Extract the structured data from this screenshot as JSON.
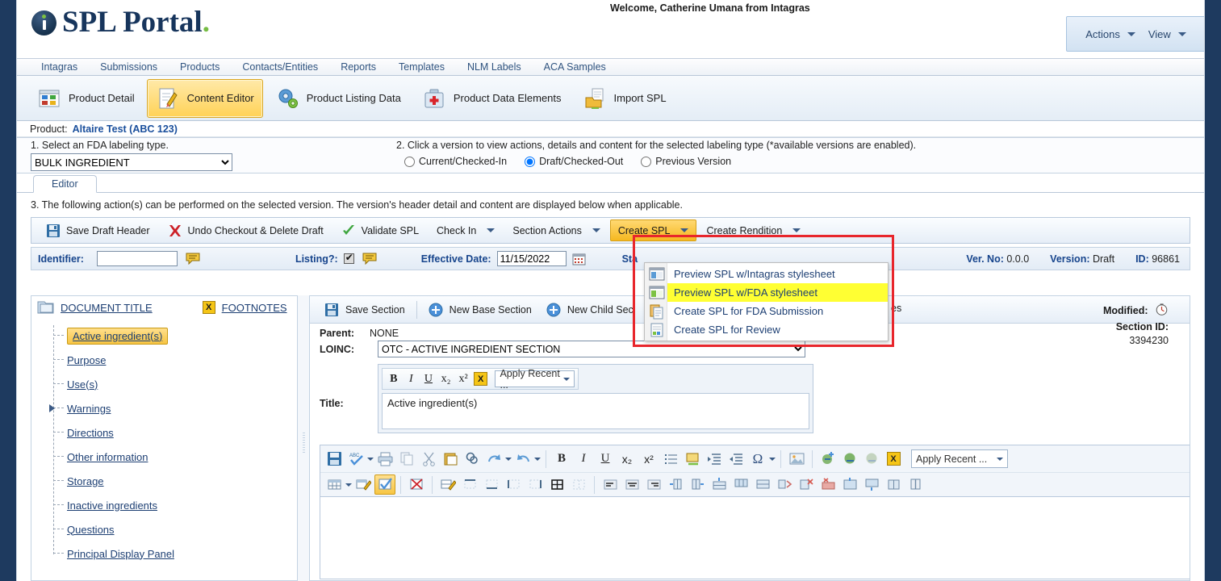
{
  "app": {
    "logo_text": "SPL Portal",
    "logo_dot": ".",
    "welcome": "Welcome, Catherine Umana from Intagras"
  },
  "header_menu": {
    "actions_label": "Actions",
    "view_label": "View"
  },
  "nav": {
    "items": [
      {
        "label": "Intagras"
      },
      {
        "label": "Submissions"
      },
      {
        "label": "Products"
      },
      {
        "label": "Contacts/Entities"
      },
      {
        "label": "Reports"
      },
      {
        "label": "Templates"
      },
      {
        "label": "NLM Labels"
      },
      {
        "label": "ACA Samples"
      }
    ]
  },
  "icon_toolbar": {
    "items": [
      {
        "label": "Product Detail",
        "icon": "grid-icon",
        "active": false
      },
      {
        "label": "Content Editor",
        "icon": "pencil-page-icon",
        "active": true
      },
      {
        "label": "Product Listing Data",
        "icon": "gears-icon",
        "active": false
      },
      {
        "label": "Product Data Elements",
        "icon": "medical-case-icon",
        "active": false
      },
      {
        "label": "Import SPL",
        "icon": "folder-import-icon",
        "active": false
      }
    ]
  },
  "product_bar": {
    "label": "Product:",
    "value": "Altaire Test (ABC 123)"
  },
  "labeling": {
    "step1": "1. Select an FDA labeling type.",
    "selected_type": "BULK INGREDIENT",
    "type_options": [
      "BULK INGREDIENT"
    ],
    "step2": "2. Click a version to view actions, details and content for the selected labeling type (*available versions are enabled).",
    "versions": [
      {
        "label": "Current/Checked-In",
        "selected": false
      },
      {
        "label": "Draft/Checked-Out",
        "selected": true
      },
      {
        "label": "Previous Version",
        "selected": false
      }
    ]
  },
  "tabs": {
    "editor_tab": "Editor"
  },
  "step3_text": "3. The following action(s) can be performed on the selected version. The version's header detail and content are displayed below when applicable.",
  "action_toolbar": {
    "save_draft_header": "Save Draft Header",
    "undo_checkout": "Undo Checkout & Delete Draft",
    "validate_spl": "Validate SPL",
    "check_in": "Check In",
    "section_actions": "Section Actions",
    "create_spl": "Create SPL",
    "create_rendition": "Create Rendition"
  },
  "create_spl_menu": {
    "items": [
      {
        "label": "Preview SPL w/Intagras stylesheet",
        "icon": "window-blue-icon",
        "highlighted": false
      },
      {
        "label": "Preview SPL w/FDA stylesheet",
        "icon": "window-green-icon",
        "highlighted": true
      },
      {
        "label": "Create SPL for FDA Submission",
        "icon": "copy-page-icon",
        "highlighted": false
      },
      {
        "label": "Create SPL for Review",
        "icon": "review-page-icon",
        "highlighted": false
      }
    ]
  },
  "identifier_bar": {
    "identifier_label": "Identifier:",
    "identifier_value": "",
    "listing_label": "Listing?:",
    "listing_checked": true,
    "effective_date_label": "Effective Date:",
    "effective_date_value": "11/15/2022",
    "status_label": "Sta",
    "ver_no_label": "Ver. No:",
    "ver_no_value": "0.0.0",
    "version_label": "Version:",
    "version_value": "Draft",
    "id_label": "ID:",
    "id_value": "96861"
  },
  "tree": {
    "document_title": "DOCUMENT TITLE",
    "footnotes": "FOOTNOTES",
    "footnotes_badge": "X",
    "nodes": [
      {
        "label": "Active ingredient(s)",
        "selected": true,
        "expandable": false
      },
      {
        "label": "Purpose",
        "selected": false,
        "expandable": false
      },
      {
        "label": "Use(s)",
        "selected": false,
        "expandable": false
      },
      {
        "label": "Warnings",
        "selected": false,
        "expandable": true
      },
      {
        "label": "Directions",
        "selected": false,
        "expandable": false
      },
      {
        "label": "Other information",
        "selected": false,
        "expandable": false
      },
      {
        "label": "Storage",
        "selected": false,
        "expandable": false
      },
      {
        "label": "Inactive ingredients",
        "selected": false,
        "expandable": false
      },
      {
        "label": "Questions",
        "selected": false,
        "expandable": false
      },
      {
        "label": "Principal Display Panel",
        "selected": false,
        "expandable": false
      }
    ]
  },
  "section_toolbar": {
    "save_section": "Save Section",
    "new_base_section": "New Base Section",
    "new_child_section": "New Child Sec",
    "hidden_button_tail": "es"
  },
  "section": {
    "parent_label": "Parent:",
    "parent_value": "NONE",
    "loinc_label": "LOINC:",
    "loinc_value": "OTC - ACTIVE INGREDIENT SECTION",
    "loinc_options": [
      "OTC - ACTIVE INGREDIENT SECTION"
    ],
    "title_label": "Title:",
    "title_value": "Active ingredient(s)",
    "modified_label": "Modified:",
    "section_id_label": "Section ID:",
    "section_id_value": "3394230"
  },
  "title_toolbar": {
    "bold": "B",
    "italic": "I",
    "underline": "U",
    "subscript": "x₂",
    "superscript": "x²",
    "special": "X",
    "apply_recent": "Apply Recent ..."
  },
  "rte_toolbar": {
    "apply_recent": "Apply Recent ...",
    "row1_icons": [
      "save-icon",
      "spellcheck-icon",
      "print-icon",
      "copy-icon",
      "cut-icon",
      "paste-icon",
      "find-icon",
      "redo-icon",
      "undo-icon",
      "bold-icon",
      "italic-icon",
      "underline-icon",
      "subscript-icon",
      "superscript-icon",
      "bullet-list-icon",
      "highlight-icon",
      "indent-increase-icon",
      "indent-decrease-icon",
      "omega-special-char-icon",
      "image-icon",
      "link-add-icon",
      "link-edit-icon",
      "link-remove-icon",
      "x-badge-icon"
    ],
    "row2_icons": [
      "insert-table-icon",
      "table-properties-icon",
      "table-check-icon",
      "delete-table-icon",
      "cell-properties-icon",
      "border-top-icon",
      "border-bottom-icon",
      "border-left-icon",
      "border-right-icon",
      "border-all-icon",
      "border-none-icon",
      "align-left-icon",
      "align-center-icon",
      "align-right-icon",
      "insert-col-left-icon",
      "insert-col-right-icon",
      "insert-row-above-icon",
      "insert-row-below-icon",
      "merge-cells-icon",
      "split-cell-icon",
      "delete-row-icon",
      "delete-col-icon",
      "delete-cells-icon",
      "merge-down-icon",
      "merge-right-icon",
      "split-vertical-icon"
    ]
  },
  "colors": {
    "brand_navy": "#17355c",
    "brand_green": "#76bc43",
    "gold_active": "#f5b820",
    "highlight_yellow": "#ffff33",
    "red_callout": "#e8262c",
    "link_blue": "#1d3f73"
  }
}
